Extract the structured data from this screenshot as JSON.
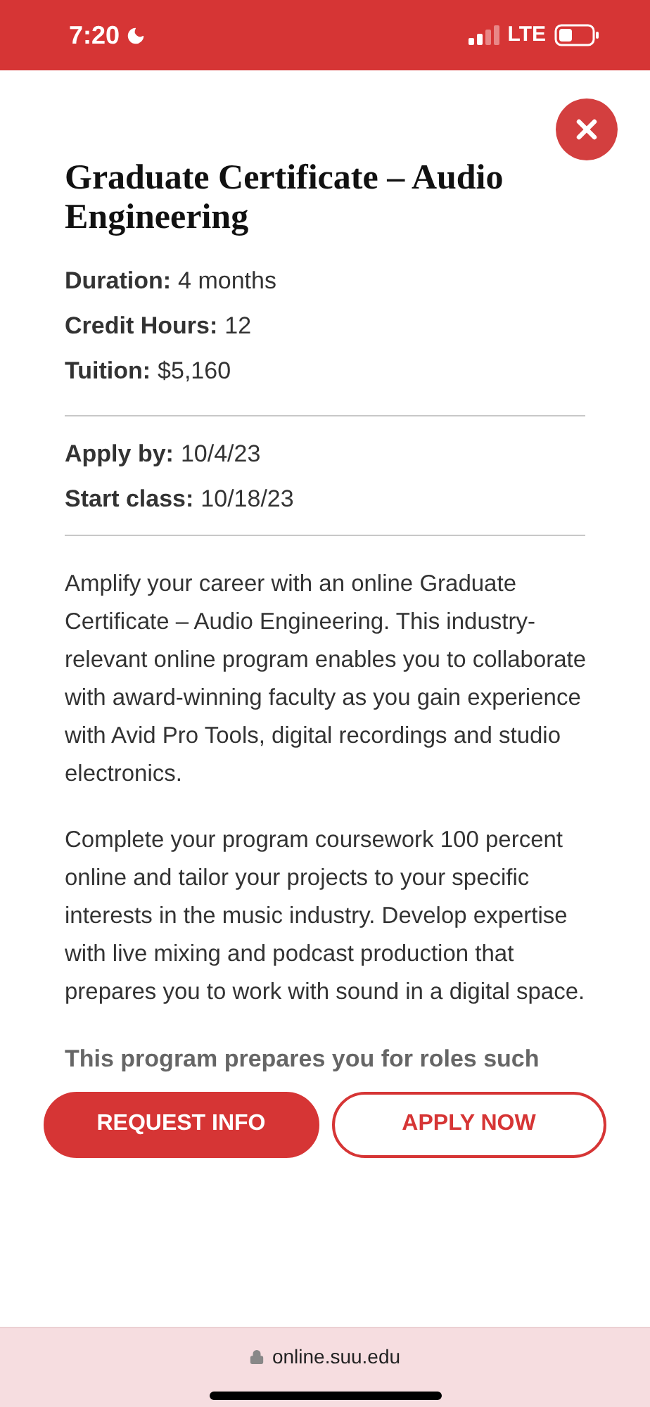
{
  "status_bar": {
    "time": "7:20",
    "network": "LTE"
  },
  "title": "Graduate Certificate – Audio Engineering",
  "facts": [
    {
      "label": "Duration:",
      "value": "4 months"
    },
    {
      "label": "Credit Hours:",
      "value": "12"
    },
    {
      "label": "Tuition:",
      "value": "$5,160"
    }
  ],
  "dates": [
    {
      "label": "Apply by:",
      "value": "10/4/23"
    },
    {
      "label": "Start class:",
      "value": "10/18/23"
    }
  ],
  "paragraphs": [
    "Amplify your career with an online Graduate Certificate – Audio Engineering. This industry-relevant online program enables you to collaborate with award-winning faculty as you gain experience with Avid Pro Tools, digital recordings and studio electronics.",
    "Complete your program coursework 100 percent online and tailor your projects to your specific interests in the music industry. Develop expertise with live mixing and podcast production that prepares you to work with sound in a digital space."
  ],
  "roles_heading": "This program prepares you for roles such",
  "buttons": [
    {
      "label": "REQUEST INFO",
      "kind": "filled"
    },
    {
      "label": "APPLY NOW",
      "kind": "outline"
    }
  ],
  "url": "online.suu.edu"
}
